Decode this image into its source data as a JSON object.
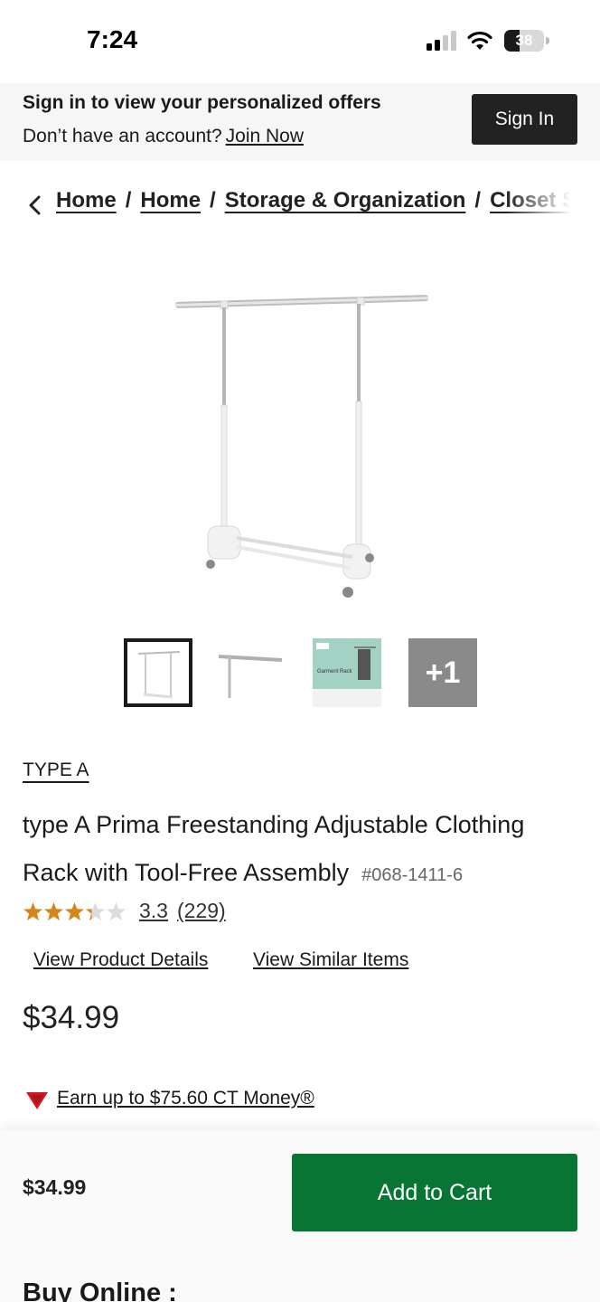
{
  "status_bar": {
    "time": "7:24",
    "battery_level": "38",
    "icons": [
      "signal-icon",
      "wifi-icon",
      "battery-icon"
    ]
  },
  "signin_banner": {
    "title": "Sign in to view your personalized offers",
    "subtitle": "Don’t have an account?",
    "join_label": "Join Now",
    "button_label": "Sign In"
  },
  "breadcrumb": {
    "back_icon": "chevron-left-icon",
    "items": [
      "Home",
      "Home",
      "Storage & Organization",
      "Closet Storage"
    ],
    "separator": "/"
  },
  "gallery": {
    "thumbnails": [
      "main-rack-view",
      "rack-bar-detail",
      "packaging-garment-rack",
      "more-images"
    ],
    "packaging_text": "Garment Rack",
    "more_label": "+1"
  },
  "product": {
    "brand": "TYPE A",
    "title": "type A Prima Freestanding Adjustable Clothing Rack with Tool-Free Assembly",
    "sku": "#068-1411-6",
    "rating": 3.3,
    "rating_value": "3.3",
    "review_count": "(229)",
    "view_details_label": "View Product Details",
    "view_similar_label": "View Similar Items",
    "price": "$34.99",
    "ct_money_label": "Earn up to $75.60 CT Money®"
  },
  "bottom_bar": {
    "price": "$34.99",
    "add_to_cart_label": "Add to Cart",
    "buy_online_label": "Buy Online :"
  },
  "colors": {
    "add_to_cart": "#087535",
    "sign_in_button": "#222222",
    "star": "#d4861a",
    "ct_triangle": "#d8141f"
  }
}
